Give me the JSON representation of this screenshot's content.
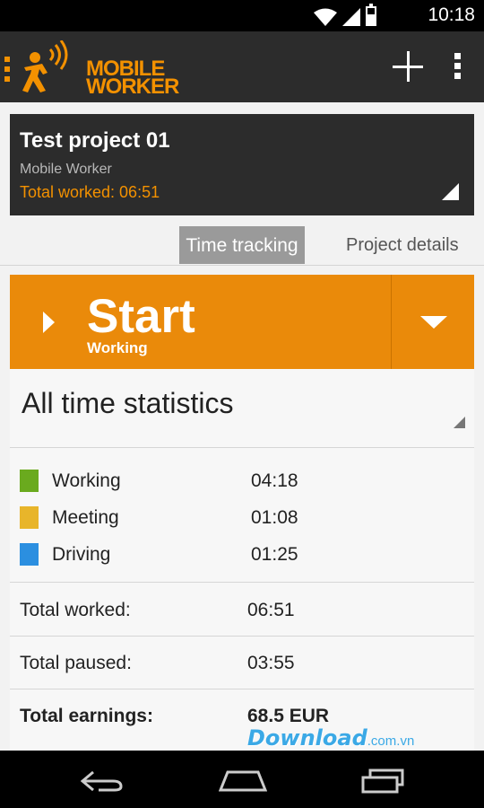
{
  "status_bar": {
    "time": "10:18"
  },
  "app_bar": {
    "logo_line1": "MOBILE",
    "logo_line2": "WORKER",
    "icons": [
      "menu-icon",
      "logo-icon",
      "add-icon",
      "overflow-menu-icon"
    ]
  },
  "project": {
    "title": "Test project 01",
    "subtitle": "Mobile Worker",
    "total_worked": "Total worked: 06:51"
  },
  "tabs": [
    {
      "label": "Time tracking",
      "active": true
    },
    {
      "label": "Project details",
      "active": false
    }
  ],
  "start_button": {
    "label": "Start",
    "activity": "Working"
  },
  "stats": {
    "title": "All time statistics",
    "activities": [
      {
        "name": "Working",
        "time": "04:18",
        "color": "#6aaa1e"
      },
      {
        "name": "Meeting",
        "time": "01:08",
        "color": "#e8b52a"
      },
      {
        "name": "Driving",
        "time": "01:25",
        "color": "#2b8fe0"
      }
    ],
    "totals": [
      {
        "label": "Total worked:",
        "value": "06:51",
        "bold": false
      },
      {
        "label": "Total paused:",
        "value": "03:55",
        "bold": false
      },
      {
        "label": "Total earnings:",
        "value": "68.5 EUR",
        "bold": true
      }
    ]
  },
  "watermark": {
    "text": "Download",
    "domain": ".com.vn"
  },
  "colors": {
    "accent": "#ea8a0a",
    "dark": "#2c2c2c"
  }
}
